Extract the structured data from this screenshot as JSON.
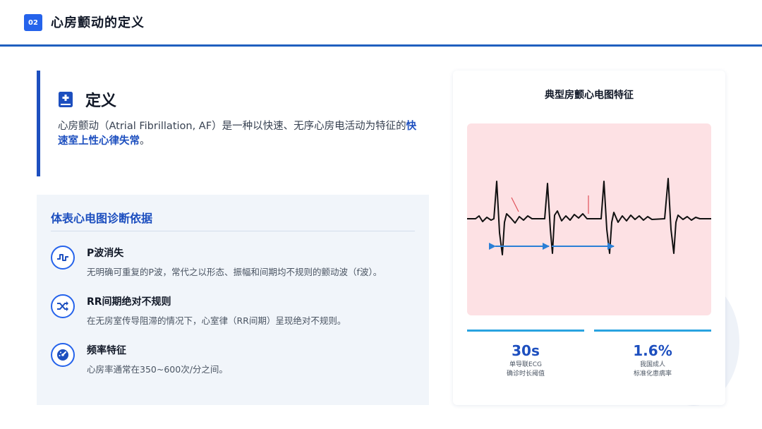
{
  "header": {
    "badge": "02",
    "title": "心房颤动的定义"
  },
  "definition": {
    "heading": "定义",
    "text_before": "心房颤动（Atrial Fibrillation, AF）是一种以快速、无序心房电活动为特征的",
    "highlight": "快速室上性心律失常",
    "text_after": "。"
  },
  "criteria": {
    "title": "体表心电图诊断依据",
    "items": [
      {
        "icon": "pulse-wave-icon",
        "title": "P波消失",
        "desc": "无明确可重复的P波，常代之以形态、振幅和间期均不规则的颤动波（f波）。"
      },
      {
        "icon": "shuffle-icon",
        "title": "RR间期绝对不规则",
        "desc": "在无房室传导阻滞的情况下，心室律（RR间期）呈现绝对不规则。"
      },
      {
        "icon": "gauge-icon",
        "title": "频率特征",
        "desc": "心房率通常在350~600次/分之间。"
      }
    ]
  },
  "ecg_card": {
    "title": "典型房颤心电图特征",
    "stats": [
      {
        "value": "30s",
        "label_line1": "单导联ECG",
        "label_line2": "确诊时长阈值"
      },
      {
        "value": "1.6%",
        "label_line1": "我国成人",
        "label_line2": "标准化患病率"
      }
    ]
  },
  "colors": {
    "accent": "#1d4fbf",
    "badge": "#2563eb",
    "stat_rule": "#29a3e0",
    "ecg_background": "#fde1e4",
    "f_wave_marks": "#e0505a",
    "rr_arrow": "#2a7fd6"
  }
}
